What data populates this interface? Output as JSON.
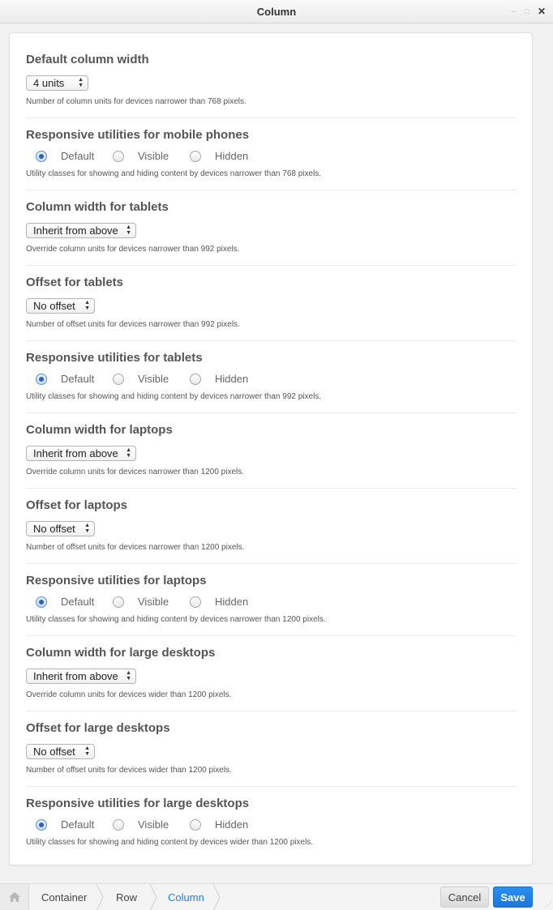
{
  "window": {
    "title": "Column",
    "minimize_glyph": "–",
    "maximize_glyph": "□",
    "close_glyph": "✕"
  },
  "sections": [
    {
      "title": "Default column width",
      "control": "select",
      "value": "4 units",
      "help": "Number of column units for devices narrower than 768 pixels."
    },
    {
      "title": "Responsive utilities for mobile phones",
      "control": "radio",
      "options": [
        "Default",
        "Visible",
        "Hidden"
      ],
      "selected": "Default",
      "help": "Utility classes for showing and hiding content by devices narrower than 768 pixels."
    },
    {
      "title": "Column width for tablets",
      "control": "select",
      "value": "Inherit from above",
      "help": "Override column units for devices narrower than 992 pixels."
    },
    {
      "title": "Offset for tablets",
      "control": "select",
      "value": "No offset",
      "help": "Number of offset units for devices narrower than 992 pixels."
    },
    {
      "title": "Responsive utilities for tablets",
      "control": "radio",
      "options": [
        "Default",
        "Visible",
        "Hidden"
      ],
      "selected": "Default",
      "help": "Utility classes for showing and hiding content by devices narrower than 992 pixels."
    },
    {
      "title": "Column width for laptops",
      "control": "select",
      "value": "Inherit from above",
      "help": "Override column units for devices narrower than 1200 pixels."
    },
    {
      "title": "Offset for laptops",
      "control": "select",
      "value": "No offset",
      "help": "Number of offset units for devices narrower than 1200 pixels."
    },
    {
      "title": "Responsive utilities for laptops",
      "control": "radio",
      "options": [
        "Default",
        "Visible",
        "Hidden"
      ],
      "selected": "Default",
      "help": "Utility classes for showing and hiding content by devices narrower than 1200 pixels."
    },
    {
      "title": "Column width for large desktops",
      "control": "select",
      "value": "Inherit from above",
      "help": "Override column units for devices wider than 1200 pixels."
    },
    {
      "title": "Offset for large desktops",
      "control": "select",
      "value": "No offset",
      "help": "Number of offset units for devices wider than 1200 pixels."
    },
    {
      "title": "Responsive utilities for large desktops",
      "control": "radio",
      "options": [
        "Default",
        "Visible",
        "Hidden"
      ],
      "selected": "Default",
      "help": "Utility classes for showing and hiding content by devices wider than 1200 pixels."
    }
  ],
  "breadcrumb": {
    "home_icon": "home-icon",
    "items": [
      "Container",
      "Row",
      "Column"
    ],
    "active": "Column"
  },
  "buttons": {
    "cancel": "Cancel",
    "save": "Save"
  },
  "colors": {
    "accent": "#2a7de1",
    "save_button": "#1c76da"
  }
}
